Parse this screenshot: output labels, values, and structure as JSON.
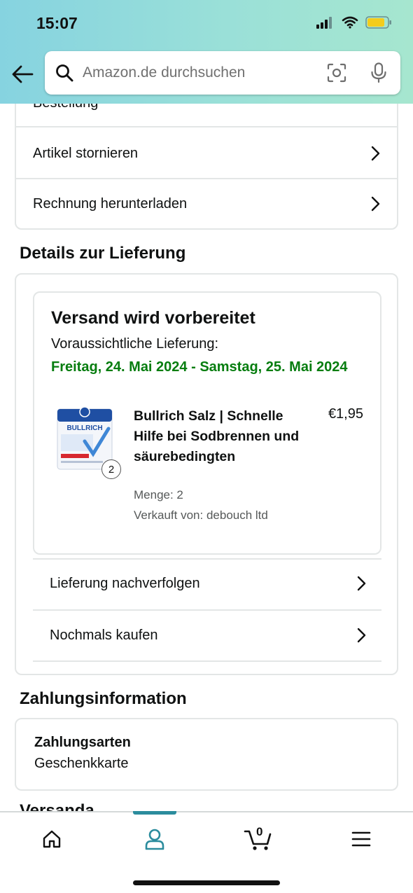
{
  "status_bar": {
    "time": "15:07"
  },
  "search": {
    "placeholder": "Amazon.de durchsuchen"
  },
  "order_actions": {
    "partial_label": "Bestellung",
    "items": [
      {
        "label": "Artikel stornieren"
      },
      {
        "label": "Rechnung herunterladen"
      }
    ]
  },
  "delivery": {
    "section_title": "Details zur Lieferung",
    "status": "Versand wird vorbereitet",
    "estimate_label": "Voraussichtliche Lieferung:",
    "estimate_dates": "Freitag, 24. Mai 2024 - Samstag, 25. Mai 2024",
    "product": {
      "title": "Bullrich Salz | Schnelle Hilfe bei Sodbrennen und säurebedingten",
      "price": "€1,95",
      "quantity_badge": "2",
      "quantity_text": "Menge: 2",
      "seller_text": "Verkauft von: debouch ltd",
      "image_brand": "BULLRICH"
    },
    "actions": [
      {
        "label": "Lieferung nachverfolgen"
      },
      {
        "label": "Nochmals kaufen"
      }
    ]
  },
  "payment": {
    "section_title": "Zahlungsinformation",
    "method_label": "Zahlungsarten",
    "method_value": "Geschenkkarte"
  },
  "next_section_partial": "Versanda",
  "bottom_nav": {
    "items": [
      {
        "icon": "home-icon"
      },
      {
        "icon": "account-icon",
        "active": true
      },
      {
        "icon": "cart-icon"
      },
      {
        "icon": "menu-icon"
      }
    ],
    "cart_count": "0",
    "active_color": "#2b8c9d"
  },
  "colors": {
    "delivery_green": "#067d0f",
    "header_gradient_start": "#86d3e0",
    "header_gradient_end": "#a6e6cf"
  }
}
